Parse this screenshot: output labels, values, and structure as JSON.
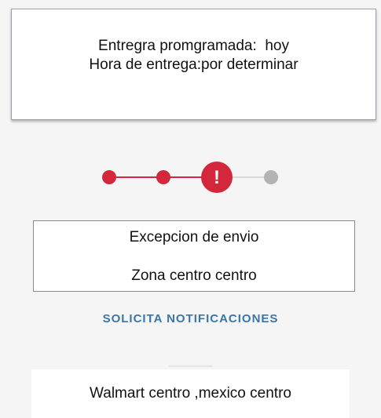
{
  "delivery": {
    "scheduled_line": "Entregra promgramada:  hoy",
    "time_line": "Hora de entrega:por determinar"
  },
  "tracker": {
    "colors": {
      "active": "#d3283b",
      "inactive": "#b3b3b3",
      "inactive_line": "#d9d9d9"
    },
    "exception_icon_text": "!"
  },
  "exception": {
    "title": "Excepcion de envio",
    "zone": "Zona centro centro"
  },
  "notifications": {
    "link_label": "SOLICITA NOTIFICACIONES",
    "color": "#3a75a8"
  },
  "store": {
    "label": "Walmart centro ,mexico centro"
  }
}
